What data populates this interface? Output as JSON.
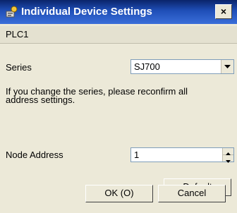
{
  "window": {
    "title": "Individual Device Settings",
    "close_label": "×"
  },
  "plc": {
    "name": "PLC1"
  },
  "series": {
    "label": "Series",
    "value": "SJ700"
  },
  "message": "If you change the series, please reconfirm all address settings.",
  "node_address": {
    "label": "Node Address",
    "value": "1"
  },
  "buttons": {
    "default_label": "Default",
    "ok_label": "OK (O)",
    "cancel_label": "Cancel"
  },
  "colors": {
    "titlebar": "#0a246a",
    "dialog_bg": "#ece9d8"
  },
  "icons": {
    "title": "settings-wrench-icon",
    "combo_arrow": "chevron-down-icon",
    "spin_up": "spin-up-icon",
    "spin_down": "spin-down-icon"
  }
}
